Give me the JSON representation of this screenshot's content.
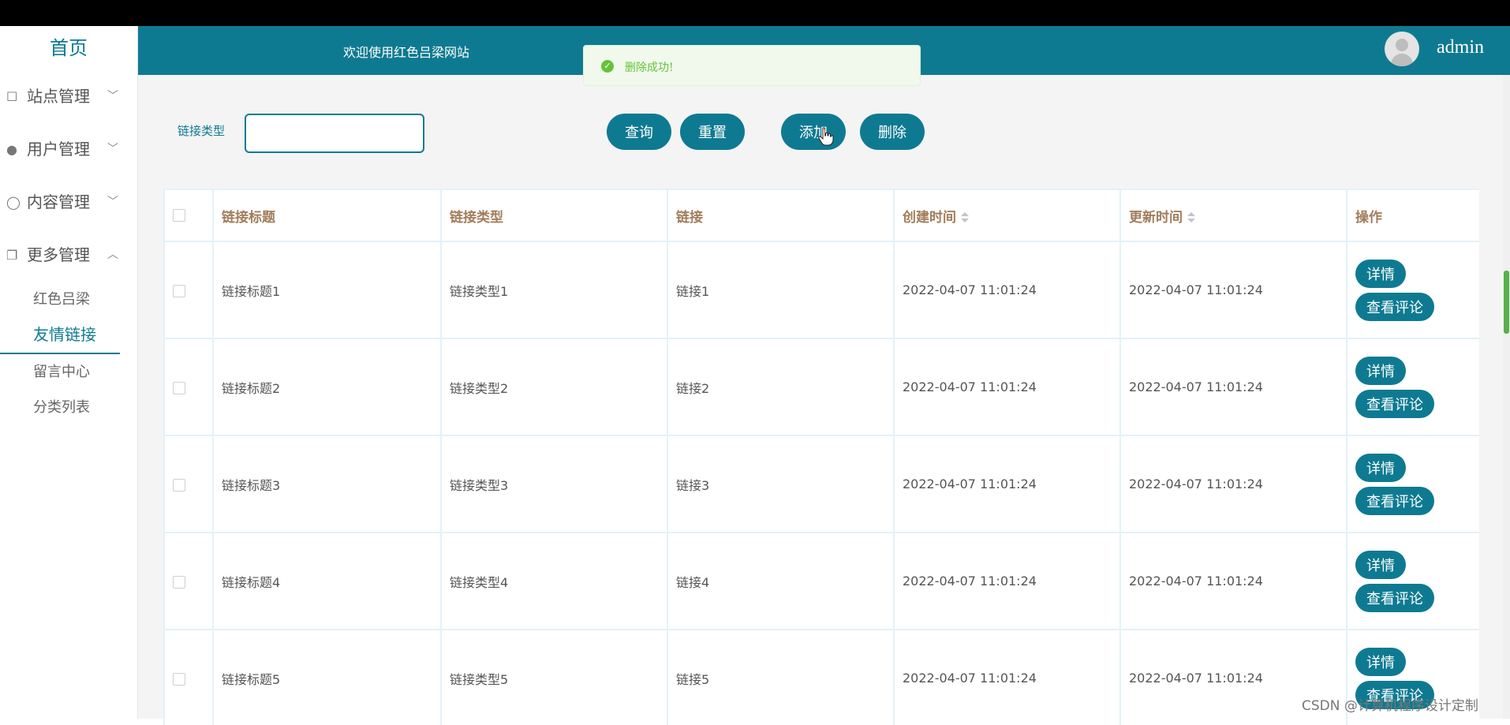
{
  "sidebar": {
    "brand": "首页",
    "menus": [
      {
        "label": "站点管理",
        "icon": "monitor-icon",
        "chev": "﹀"
      },
      {
        "label": "用户管理",
        "icon": "user-icon",
        "chev": "﹀"
      },
      {
        "label": "内容管理",
        "icon": "comment-icon",
        "chev": "﹀"
      },
      {
        "label": "更多管理",
        "icon": "copy-icon",
        "chev": "︿"
      }
    ],
    "sub_items": [
      "红色吕梁",
      "友情链接",
      "留言中心",
      "分类列表"
    ]
  },
  "header": {
    "welcome": "欢迎使用红色吕梁网站",
    "user": "admin",
    "accent": "#0e7a91"
  },
  "toast": {
    "message": "删除成功!",
    "icon": "check-circle-icon",
    "color": "#67c23a"
  },
  "filter": {
    "label": "链接类型",
    "value": ""
  },
  "buttons": {
    "search": "查询",
    "reset": "重置",
    "add": "添加",
    "delete": "删除"
  },
  "table": {
    "columns": [
      "链接标题",
      "链接类型",
      "链接",
      "创建时间",
      "更新时间",
      "操作"
    ],
    "rows": [
      {
        "title": "链接标题1",
        "type": "链接类型1",
        "link": "链接1",
        "created": "2022-04-07 11:01:24",
        "updated": "2022-04-07 11:01:24"
      },
      {
        "title": "链接标题2",
        "type": "链接类型2",
        "link": "链接2",
        "created": "2022-04-07 11:01:24",
        "updated": "2022-04-07 11:01:24"
      },
      {
        "title": "链接标题3",
        "type": "链接类型3",
        "link": "链接3",
        "created": "2022-04-07 11:01:24",
        "updated": "2022-04-07 11:01:24"
      },
      {
        "title": "链接标题4",
        "type": "链接类型4",
        "link": "链接4",
        "created": "2022-04-07 11:01:24",
        "updated": "2022-04-07 11:01:24"
      },
      {
        "title": "链接标题5",
        "type": "链接类型5",
        "link": "链接5",
        "created": "2022-04-07 11:01:24",
        "updated": "2022-04-07 11:01:24"
      }
    ],
    "row_actions": {
      "detail": "详情",
      "comments": "查看评论"
    }
  },
  "watermark": "CSDN @计算机程序设计定制"
}
